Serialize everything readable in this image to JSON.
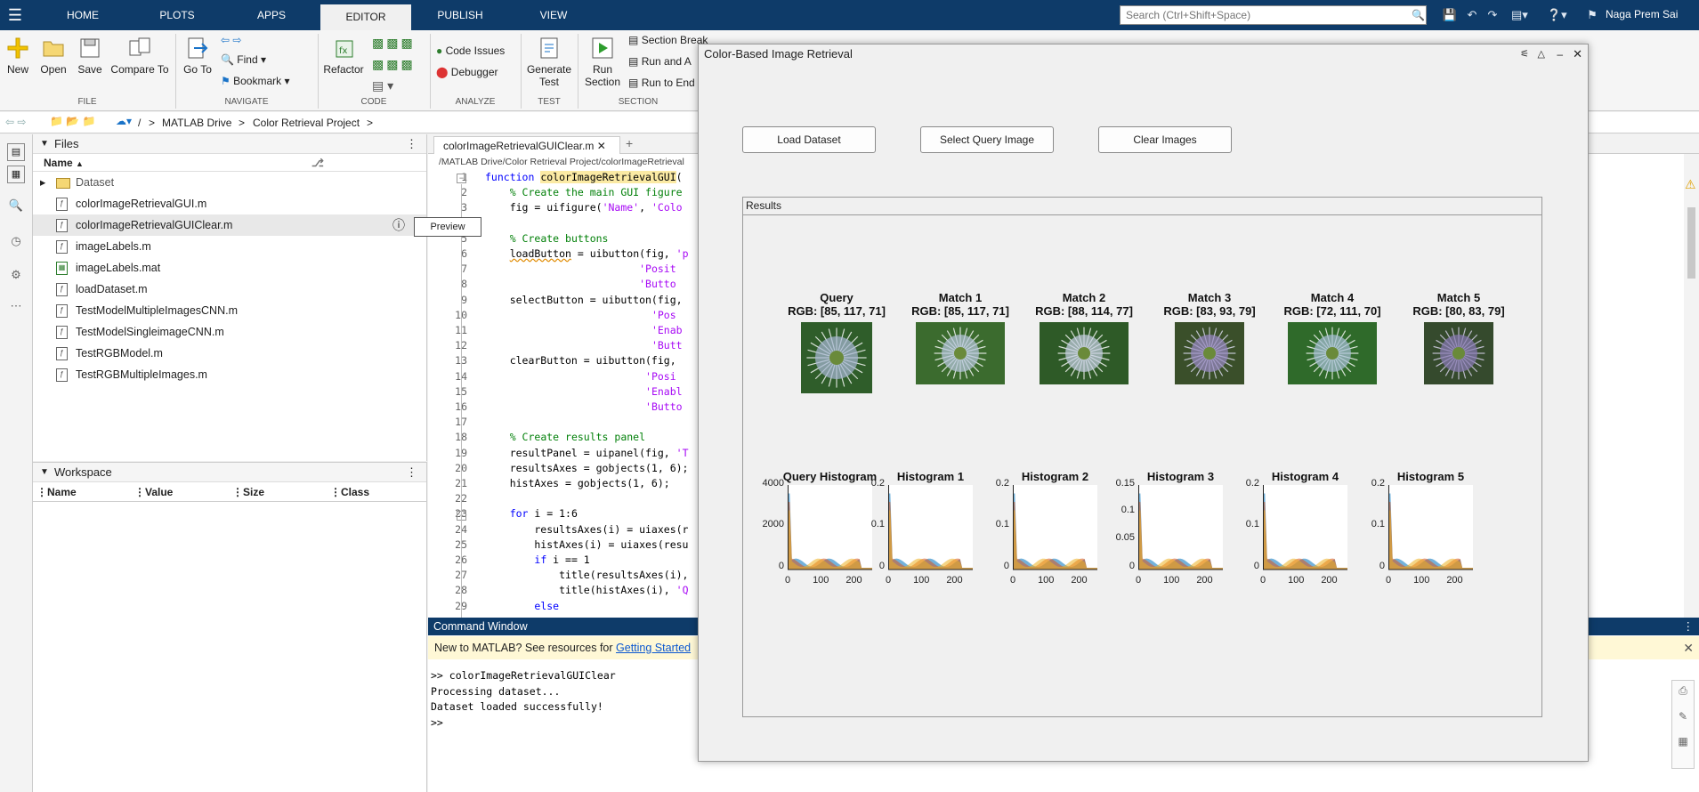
{
  "menu": {
    "tabs": [
      "HOME",
      "PLOTS",
      "APPS",
      "EDITOR",
      "PUBLISH",
      "VIEW"
    ],
    "active_tab": "EDITOR",
    "search_placeholder": "Search (Ctrl+Shift+Space)",
    "user": "Naga Prem Sai"
  },
  "ribbon": {
    "file": {
      "new": "New",
      "open": "Open",
      "save": "Save",
      "compare": "Compare To",
      "section": "FILE"
    },
    "navigate": {
      "goto": "Go To",
      "find": "Find",
      "bookmark": "Bookmark",
      "section": "NAVIGATE"
    },
    "code": {
      "refactor": "Refactor",
      "section": "CODE"
    },
    "analyze": {
      "code_issues": "Code Issues",
      "debugger": "Debugger",
      "section": "ANALYZE"
    },
    "test": {
      "generate": "Generate",
      "generate2": "Test",
      "section": "TEST"
    },
    "section_grp": {
      "run_section": "Run",
      "run_section2": "Section",
      "section_break": "Section Break",
      "run_and": "Run and A",
      "run_to_end": "Run to End",
      "section": "SECTION"
    }
  },
  "address": {
    "root": "/",
    "drive": "MATLAB Drive",
    "folder": "Color Retrieval Project"
  },
  "files_panel": {
    "title": "Files",
    "col_name": "Name",
    "items": [
      {
        "name": "Dataset",
        "type": "folder"
      },
      {
        "name": "colorImageRetrievalGUI.m",
        "type": "m"
      },
      {
        "name": "colorImageRetrievalGUIClear.m",
        "type": "m"
      },
      {
        "name": "imageLabels.m",
        "type": "m"
      },
      {
        "name": "imageLabels.mat",
        "type": "mat"
      },
      {
        "name": "loadDataset.m",
        "type": "m"
      },
      {
        "name": "TestModelMultipleImagesCNN.m",
        "type": "m"
      },
      {
        "name": "TestModelSingleimageCNN.m",
        "type": "m"
      },
      {
        "name": "TestRGBModel.m",
        "type": "m"
      },
      {
        "name": "TestRGBMultipleImages.m",
        "type": "m"
      }
    ],
    "tooltip": "Preview"
  },
  "workspace": {
    "title": "Workspace",
    "cols": [
      "Name",
      "Value",
      "Size",
      "Class"
    ]
  },
  "editor": {
    "tab": "colorImageRetrievalGUIClear.m",
    "path": "/MATLAB Drive/Color Retrieval Project/colorImageRetrieval",
    "line_numbers": [
      "1",
      "2",
      "3",
      "4",
      "5",
      "6",
      "7",
      "8",
      "9",
      "10",
      "11",
      "12",
      "13",
      "14",
      "15",
      "16",
      "17",
      "18",
      "19",
      "20",
      "21",
      "22",
      "23",
      "24",
      "25",
      "26",
      "27",
      "28",
      "29"
    ]
  },
  "command_window": {
    "title": "Command Window",
    "banner": "New to MATLAB? See resources for ",
    "banner_link": "Getting Started",
    "lines": [
      ">> colorImageRetrievalGUIClear",
      "Processing dataset...",
      "Dataset loaded successfully!",
      ">>"
    ]
  },
  "figure": {
    "title": "Color-Based Image Retrieval",
    "buttons": {
      "load": "Load Dataset",
      "select": "Select Query Image",
      "clear": "Clear Images"
    },
    "panel_title": "Results",
    "images": [
      {
        "title": "Query",
        "rgb": "RGB: [85, 117, 71]"
      },
      {
        "title": "Match 1",
        "rgb": "RGB: [85, 117, 71]"
      },
      {
        "title": "Match 2",
        "rgb": "RGB: [88, 114, 77]"
      },
      {
        "title": "Match 3",
        "rgb": "RGB: [83, 93, 79]"
      },
      {
        "title": "Match 4",
        "rgb": "RGB: [72, 111, 70]"
      },
      {
        "title": "Match 5",
        "rgb": "RGB: [80, 83, 79]"
      }
    ],
    "histograms": [
      {
        "title": "Query Histogram",
        "yticks": [
          "4000",
          "2000",
          "0"
        ]
      },
      {
        "title": "Histogram 1",
        "yticks": [
          "0.2",
          "0.1",
          "0"
        ]
      },
      {
        "title": "Histogram 2",
        "yticks": [
          "0.2",
          "0.1",
          "0"
        ]
      },
      {
        "title": "Histogram 3",
        "yticks": [
          "0.15",
          "0.1",
          "0.05",
          "0"
        ]
      },
      {
        "title": "Histogram 4",
        "yticks": [
          "0.2",
          "0.1",
          "0"
        ]
      },
      {
        "title": "Histogram 5",
        "yticks": [
          "0.2",
          "0.1",
          "0"
        ]
      }
    ],
    "xticks": [
      "0",
      "100",
      "200"
    ]
  },
  "colors": {
    "menu_bg": "#0e3b69",
    "accent": "#0e3b69",
    "hist_blue": "#0072bd",
    "hist_orange": "#d95319",
    "hist_yellow": "#edb120"
  }
}
